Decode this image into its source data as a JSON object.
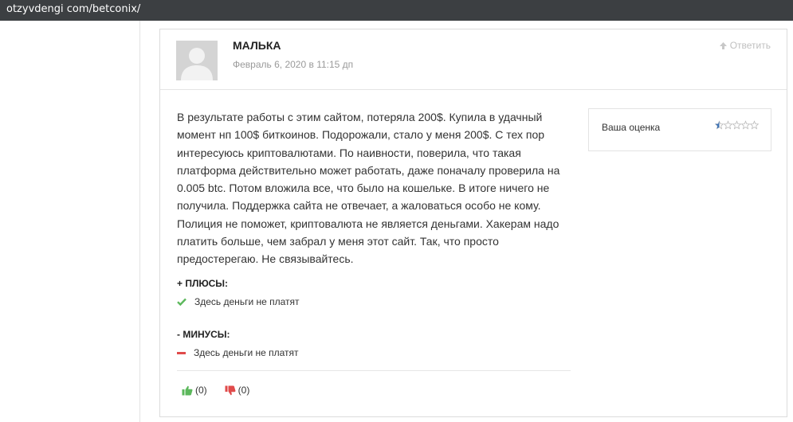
{
  "browser": {
    "url": "otzyvdengi com/betconix/"
  },
  "review": {
    "author": "МАЛЬКА",
    "date": "Февраль 6, 2020 в 11:15 дп",
    "reply_label": "Ответить",
    "text": "В результате работы с этим сайтом, потеряла 200$. Купила в удачный момент нп 100$ биткоинов. Подорожали, стало у меня 200$. С тех пор интересуюсь криптовалютами. По наивности, поверила, что такая платформа действительно может работать, даже поначалу проверила на 0.005 btc. Потом вложила все, что было на кошельке. В итоге ничего не получила. Поддержка сайта не отвечает, а жаловаться особо не кому. Полиция не поможет, криптовалюта не является деньгами. Хакерам надо платить больше, чем забрал у меня этот сайт. Так, что просто предостерегаю. Не связывайтесь.",
    "rating": {
      "label": "Ваша оценка",
      "value": 0.5,
      "max": 5
    },
    "pros": {
      "title": "+ ПЛЮСЫ:",
      "items": [
        "Здесь деньги не платят"
      ]
    },
    "cons": {
      "title": "- МИНУСЫ:",
      "items": [
        "Здесь деньги не платят"
      ]
    },
    "votes": {
      "up": "(0)",
      "down": "(0)"
    }
  },
  "colors": {
    "accent_green": "#5cb85c",
    "accent_red": "#e04b4b",
    "star_blue": "#3f73b5",
    "urlbar_bg": "#3c3f42"
  },
  "icons": {
    "reply": "arrow-up-icon",
    "pros": "check-icon",
    "cons": "minus-icon",
    "like": "thumbs-up-icon",
    "dislike": "thumbs-down-icon",
    "star": "star-icon"
  }
}
